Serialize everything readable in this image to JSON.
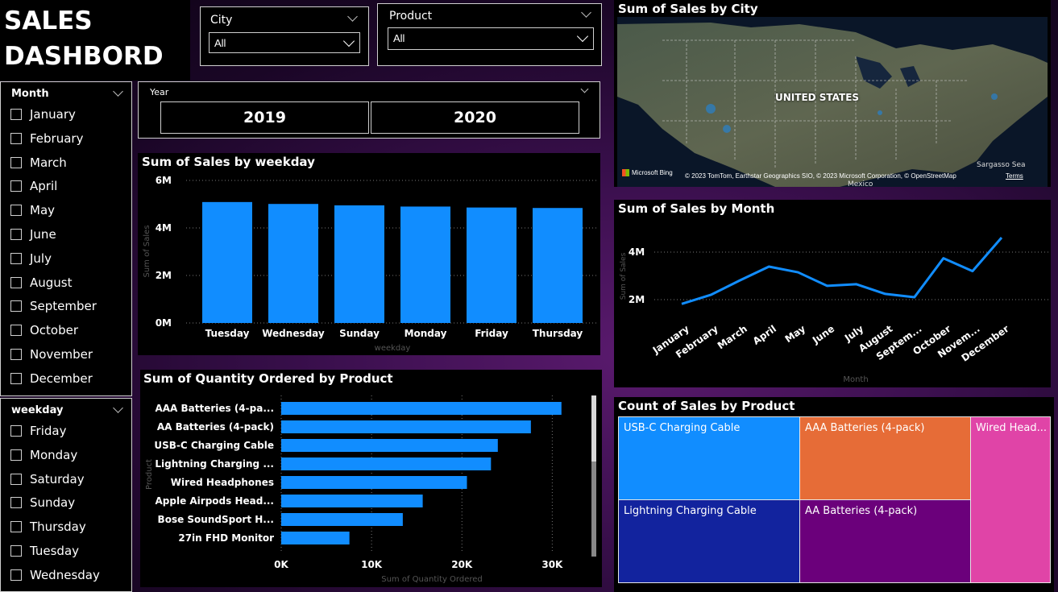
{
  "header": {
    "title_line1": "SALES",
    "title_line2": "DASHBORD"
  },
  "slicers": {
    "city": {
      "label": "City",
      "value": "All"
    },
    "product": {
      "label": "Product",
      "value": "All"
    },
    "year": {
      "label": "Year",
      "options": [
        "2019",
        "2020"
      ]
    },
    "month": {
      "label": "Month",
      "items": [
        "January",
        "February",
        "March",
        "April",
        "May",
        "June",
        "July",
        "August",
        "September",
        "October",
        "November",
        "December"
      ]
    },
    "weekday": {
      "label": "weekday",
      "items": [
        "Friday",
        "Monday",
        "Saturday",
        "Sunday",
        "Thursday",
        "Tuesday",
        "Wednesday"
      ]
    }
  },
  "map": {
    "title": "Sum of Sales by City",
    "country_label": "UNITED STATES",
    "sea_label": "Sargasso Sea",
    "mexico_label": "Mexico",
    "brand": "Microsoft Bing",
    "attribution": "© 2023 TomTom, Earthstar Geographics SIO, © 2023 Microsoft Corporation, © OpenStreetMap",
    "terms": "Terms"
  },
  "treemap": {
    "title": "Count of Sales by Product",
    "tiles": [
      {
        "label": "USB-C Charging Cable",
        "color": "#118dff"
      },
      {
        "label": "AAA Batteries (4-pack)",
        "color": "#e66c37"
      },
      {
        "label": "Wired Head...",
        "color": "#e044a7"
      },
      {
        "label": "Lightning Charging Cable",
        "color": "#12239e"
      },
      {
        "label": "AA Batteries (4-pack)",
        "color": "#6b007b"
      }
    ]
  },
  "chart_data": [
    {
      "type": "bar",
      "title": "Sum of Sales by weekday",
      "xlabel": "weekday",
      "ylabel": "Sum of Sales",
      "categories": [
        "Tuesday",
        "Wednesday",
        "Sunday",
        "Monday",
        "Friday",
        "Thursday"
      ],
      "values": [
        5.09,
        5.01,
        4.95,
        4.9,
        4.86,
        4.84
      ],
      "yticks": [
        "0M",
        "2M",
        "4M",
        "6M"
      ],
      "ylim": [
        0,
        6
      ],
      "unit": "M",
      "color": "#118dff"
    },
    {
      "type": "line",
      "title": "Sum of Sales by Month",
      "xlabel": "Month",
      "ylabel": "Sum of Sales",
      "categories": [
        "January",
        "February",
        "March",
        "April",
        "May",
        "June",
        "July",
        "August",
        "Septem...",
        "October",
        "Novem...",
        "December"
      ],
      "values": [
        1.82,
        2.2,
        2.81,
        3.39,
        3.15,
        2.58,
        2.65,
        2.24,
        2.1,
        3.74,
        3.2,
        4.61
      ],
      "yticks": [
        "2M",
        "4M"
      ],
      "ytick_values": [
        2,
        4
      ],
      "unit": "M",
      "color": "#118dff"
    },
    {
      "type": "bar",
      "orientation": "horizontal",
      "title": "Sum of Quantity Ordered by Product",
      "xlabel": "Sum of Quantity Ordered",
      "ylabel": "Product",
      "categories": [
        "AAA Batteries (4-pa...",
        "AA Batteries (4-pack)",
        "USB-C Charging Cable",
        "Lightning Charging ...",
        "Wired Headphones",
        "Apple Airpods Head...",
        "Bose SoundSport H...",
        "27in FHD Monitor"
      ],
      "values": [
        31017,
        27635,
        23975,
        23217,
        20557,
        15661,
        13457,
        7550
      ],
      "xticks": [
        "0K",
        "10K",
        "20K",
        "30K"
      ],
      "xlim": [
        0,
        33000
      ],
      "color": "#118dff"
    }
  ]
}
